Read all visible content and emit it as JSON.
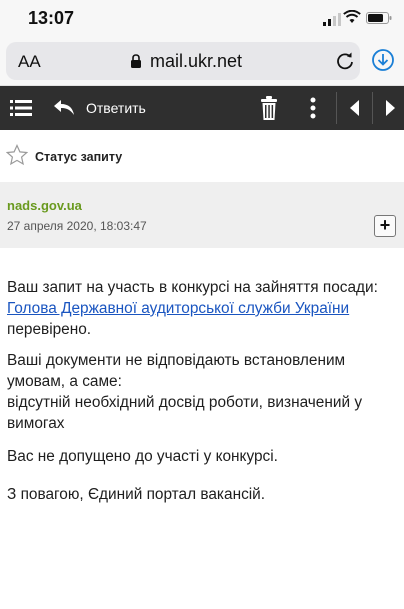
{
  "status_bar": {
    "time": "13:07"
  },
  "browser": {
    "text_size_label": "AA",
    "url": "mail.ukr.net"
  },
  "toolbar": {
    "reply_label": "Ответить"
  },
  "message": {
    "subject": "Статус запиту",
    "sender": "nads.gov.ua",
    "date": "27 апреля 2020, 18:03:47",
    "expand_label": "+",
    "paragraph1_text": "Ваш запит на участь в конкурсі на зайняття посади:",
    "paragraph1_link": "Голова Державної аудиторської служби України",
    "paragraph1_end": "перевірено.",
    "paragraph2_line1": "Ваші документи не відповідають встановленим умовам, а саме:",
    "paragraph2_line2": "відсутній необхідний досвід роботи, визначений у вимогах",
    "paragraph3": "Вас не допущено до участі у конкурсі.",
    "paragraph4": "З повагою, Єдиний портал вакансій."
  },
  "colors": {
    "toolbar_bg": "#2f2f2f",
    "sender": "#6a9a1f",
    "link": "#1a55c0",
    "download_accent": "#1a7fd6"
  }
}
